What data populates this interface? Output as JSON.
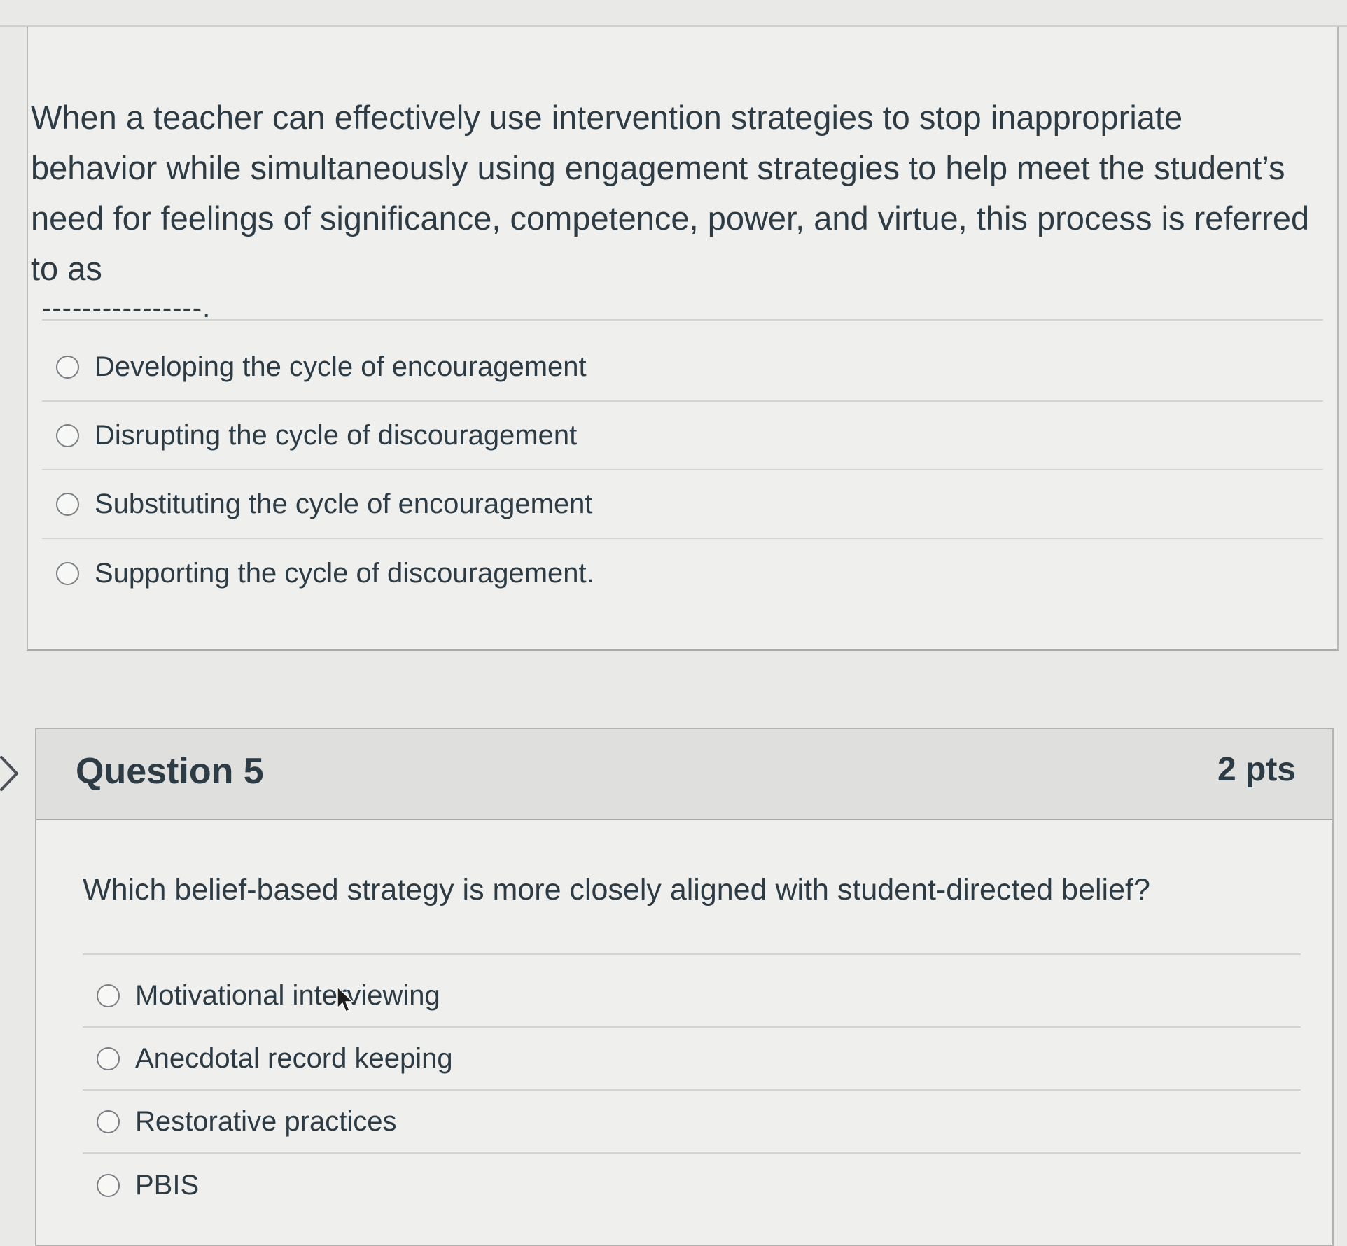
{
  "question4": {
    "stem": "When a teacher can effectively use intervention strategies to stop inappropriate behavior while simultaneously using engagement strategies to help meet the student’s need for feelings of significance, competence, power, and virtue, this process is referred to as",
    "blank": "----------------.",
    "answers": [
      {
        "label": "Developing the cycle of encouragement"
      },
      {
        "label": "Disrupting the cycle of discouragement"
      },
      {
        "label": "Substituting the cycle of encouragement"
      },
      {
        "label": "Supporting the cycle of discouragement."
      }
    ]
  },
  "question5": {
    "title": "Question 5",
    "points": "2 pts",
    "stem": "Which belief-based strategy is more closely aligned with student-directed belief?",
    "answers": [
      {
        "label": "Motivational interviewing"
      },
      {
        "label": "Anecdotal record keeping"
      },
      {
        "label": "Restorative practices"
      },
      {
        "label": "PBIS"
      }
    ]
  },
  "icons": {
    "nav": "chevron-right-icon",
    "pointer": "mouse-cursor-icon"
  },
  "colors": {
    "text": "#2d3b45",
    "header_background": "#dfdfdd",
    "page_background": "#efefed"
  }
}
